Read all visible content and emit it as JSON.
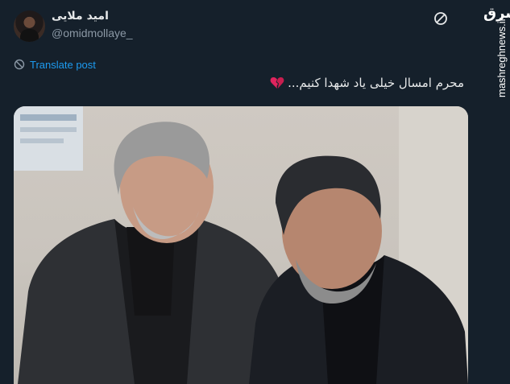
{
  "author": {
    "display_name": "امید ملایی",
    "handle": "@omidmollaye_"
  },
  "actions": {
    "translate_label": "Translate post"
  },
  "tweet": {
    "text": "محرم امسال خیلی یاد شهدا کنیم..."
  },
  "watermark": {
    "logo_text": "مشرق",
    "site": "mashreghnews.ir"
  },
  "icons": {
    "grok": "grok-icon",
    "translate": "globe-icon",
    "emoji": "broken-heart-icon"
  },
  "colors": {
    "background": "#15202b",
    "accent": "#1d9bf0",
    "secondary_text": "#8b98a5"
  }
}
